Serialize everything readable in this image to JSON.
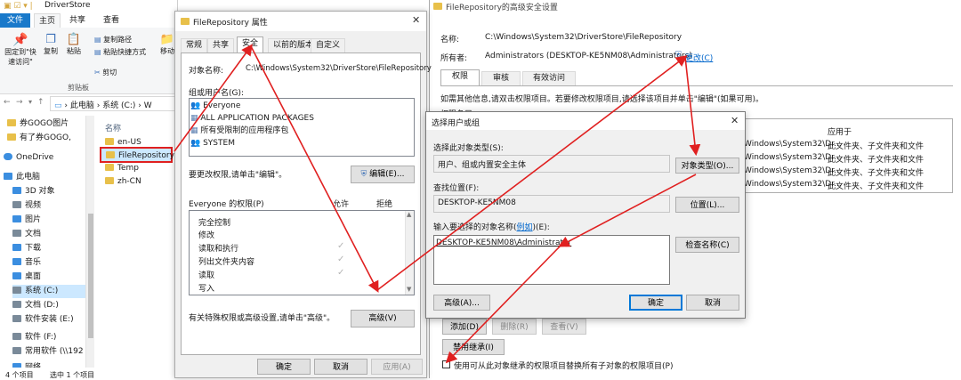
{
  "explorer": {
    "title": "DriverStore",
    "ribbon_tabs": [
      "文件",
      "主页",
      "共享",
      "查看"
    ],
    "ribbon": {
      "pin_label": "固定到\"快速访问\"",
      "copy_label": "复制",
      "paste_label": "粘贴",
      "copy_path_label": "复制路径",
      "paste_shortcut_label": "粘贴快捷方式",
      "cut_label": "剪切",
      "move_label": "移动",
      "group_label": "剪贴板"
    },
    "breadcrumb": [
      "此电脑",
      "系统 (C:)",
      "W"
    ],
    "nav_items": [
      {
        "label": "券GOGO图片",
        "icon": "folder-icon"
      },
      {
        "label": "有了券GOGO,",
        "icon": "folder-icon"
      },
      {
        "label": "OneDrive",
        "icon": "cloud-icon"
      },
      {
        "label": "此电脑",
        "icon": "computer-icon"
      },
      {
        "label": "3D 对象",
        "icon": "cube-icon"
      },
      {
        "label": "视频",
        "icon": "video-icon"
      },
      {
        "label": "图片",
        "icon": "picture-icon"
      },
      {
        "label": "文档",
        "icon": "document-icon"
      },
      {
        "label": "下载",
        "icon": "download-icon"
      },
      {
        "label": "音乐",
        "icon": "music-icon"
      },
      {
        "label": "桌面",
        "icon": "desktop-icon"
      },
      {
        "label": "系统 (C:)",
        "icon": "drive-icon"
      },
      {
        "label": "文档 (D:)",
        "icon": "drive-icon"
      },
      {
        "label": "软件安装 (E:)",
        "icon": "drive-icon"
      },
      {
        "label": "软件 (F:)",
        "icon": "drive-icon"
      },
      {
        "label": "常用软件 (\\\\192",
        "icon": "network-drive-icon"
      },
      {
        "label": "网络",
        "icon": "network-icon"
      }
    ],
    "column_header": "名称",
    "files": [
      "en-US",
      "FileRepository",
      "Temp",
      "zh-CN"
    ],
    "status_count": "4 个项目",
    "status_selected": "选中 1 个项目"
  },
  "props": {
    "title": "FileRepository 属性",
    "tabs": [
      "常规",
      "共享",
      "安全",
      "以前的版本",
      "自定义"
    ],
    "object_label": "对象名称:",
    "object_value": "C:\\Windows\\System32\\DriverStore\\FileRepository",
    "groups_label": "组或用户名(G):",
    "groups": [
      "Everyone",
      "ALL APPLICATION PACKAGES",
      "所有受限制的应用程序包",
      "SYSTEM"
    ],
    "change_hint": "要更改权限,请单击\"编辑\"。",
    "edit_button": "编辑(E)...",
    "perm_title": "Everyone 的权限(P)",
    "allow": "允许",
    "deny": "拒绝",
    "perms": [
      "完全控制",
      "修改",
      "读取和执行",
      "列出文件夹内容",
      "读取",
      "写入"
    ],
    "perm_allowed": [
      false,
      false,
      true,
      true,
      true,
      false
    ],
    "advanced_hint": "有关特殊权限或高级设置,请单击\"高级\"。",
    "advanced_button": "高级(V)",
    "ok": "确定",
    "cancel": "取消",
    "apply": "应用(A)"
  },
  "adv": {
    "title": "FileRepository的高级安全设置",
    "name_label": "名称:",
    "name_value": "C:\\Windows\\System32\\DriverStore\\FileRepository",
    "owner_label": "所有者:",
    "owner_value": "Administrators (DESKTOP-KE5NM08\\Administrators)",
    "change_link": "更改(C)",
    "tabs": [
      "权限",
      "审核",
      "有效访问"
    ],
    "info_text": "如需其他信息,请双击权限项目。若要修改权限项目,请选择该项目并单击\"编辑\"(如果可用)。",
    "entries_label": "权限条目",
    "apply_to_header": "应用于",
    "rows": [
      {
        "path": "Windows\\System32\\Dr...",
        "apply": "此文件夹、子文件夹和文件"
      },
      {
        "path": "Windows\\System32\\Dr...",
        "apply": "此文件夹、子文件夹和文件"
      },
      {
        "path": "Windows\\System32\\Dr...",
        "apply": "此文件夹、子文件夹和文件"
      },
      {
        "path": "Windows\\System32\\Dr...",
        "apply": "此文件夹、子文件夹和文件"
      }
    ],
    "add": "添加(D)",
    "remove": "删除(R)",
    "view": "查看(V)",
    "disable_inherit": "禁用继承(I)",
    "replace_label": "使用可从此对象继承的权限项目替换所有子对象的权限项目(P)"
  },
  "select": {
    "title": "选择用户或组",
    "type_label": "选择此对象类型(S):",
    "type_value": "用户、组或内置安全主体",
    "type_button": "对象类型(O)...",
    "location_label": "查找位置(F):",
    "location_value": "DESKTOP-KE5NM08",
    "location_button": "位置(L)...",
    "enter_label_pre": "输入要选择的对象名称(",
    "enter_label_link": "例如",
    "enter_label_post": ")(E):",
    "enter_value": "DESKTOP-KE5NM08\\Administrator",
    "check_button": "检查名称(C)",
    "advanced_button": "高级(A)...",
    "ok": "确定",
    "cancel": "取消"
  },
  "colors": {
    "accent": "#0078d7",
    "arrow": "#e02020",
    "ribbon_file_tab": "#1979ca"
  }
}
